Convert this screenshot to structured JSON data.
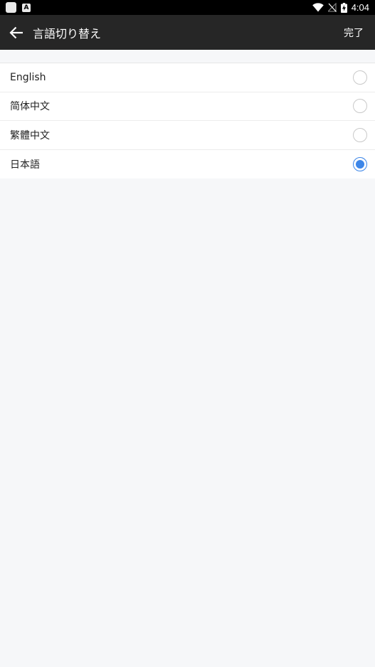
{
  "status_bar": {
    "time": "4:04",
    "notification_icons": [
      "app-notification-icon",
      "a-icon"
    ],
    "system_icons": [
      "wifi-icon",
      "no-signal-icon",
      "battery-charging-icon"
    ]
  },
  "app_bar": {
    "title": "言語切り替え",
    "done_label": "完了"
  },
  "languages": [
    {
      "label": "English",
      "selected": false
    },
    {
      "label": "简体中文",
      "selected": false
    },
    {
      "label": "繁體中文",
      "selected": false
    },
    {
      "label": "日本語",
      "selected": true
    }
  ],
  "colors": {
    "app_bar": "#262626",
    "accent": "#3d86e8",
    "background": "#f6f7f9"
  }
}
